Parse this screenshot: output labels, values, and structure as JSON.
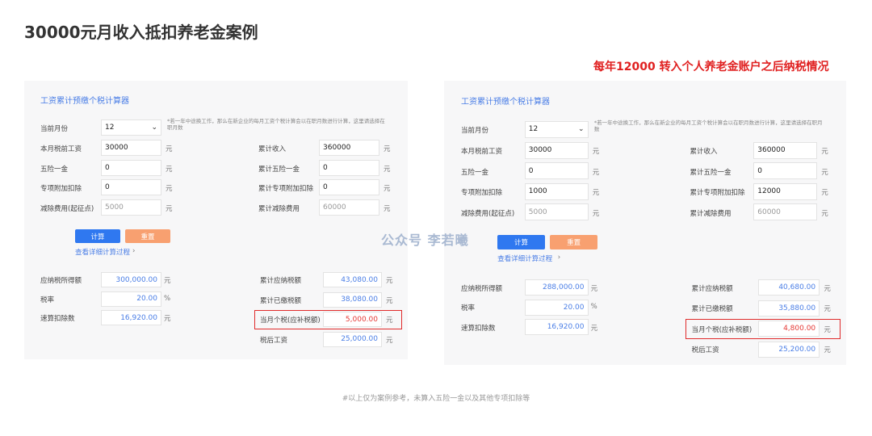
{
  "page": {
    "title": "30000元月收入抵扣养老金案例",
    "right_heading": "每年12000 转入个人养老金账户之后纳税情况",
    "watermark": "公众号 李若曦",
    "footnote": "#以上仅为案例参考，未算入五险一金以及其他专项扣除等"
  },
  "colors": {
    "accent": "#2f78f0",
    "reset": "#f8a070",
    "highlight": "#e02b2b"
  },
  "panels": [
    {
      "title": "工资累计预缴个税计算器",
      "month_label": "当前月份",
      "month_value": "12",
      "note": "*若一年中途换工作，那么在新企业的每月工资个税计算会以在职月数进行计算，这里请选择在职月数",
      "inputs": [
        {
          "label": "本月税前工资",
          "value": "30000",
          "unit": "元",
          "cum_label": "累计收入",
          "cum_value": "360000",
          "cum_unit": "元"
        },
        {
          "label": "五险一金",
          "value": "0",
          "unit": "元",
          "cum_label": "累计五险一金",
          "cum_value": "0",
          "cum_unit": "元"
        },
        {
          "label": "专项附加扣除",
          "value": "0",
          "unit": "元",
          "cum_label": "累计专项附加扣除",
          "cum_value": "0",
          "cum_unit": "元"
        },
        {
          "label": "减除费用(起征点)",
          "value": "5000",
          "unit": "元",
          "cum_label": "累计减除费用",
          "cum_value": "60000",
          "cum_unit": "元"
        }
      ],
      "calc_label": "计算",
      "reset_label": "重置",
      "detail_link": "查看详细计算过程",
      "results_left": [
        {
          "label": "应纳税所得额",
          "value": "300,000.00",
          "unit": "元"
        },
        {
          "label": "税率",
          "value": "20.00",
          "unit": "%"
        },
        {
          "label": "速算扣除数",
          "value": "16,920.00",
          "unit": "元"
        }
      ],
      "results_right": [
        {
          "label": "累计应纳税额",
          "value": "43,080.00",
          "unit": "元"
        },
        {
          "label": "累计已缴税额",
          "value": "38,080.00",
          "unit": "元"
        },
        {
          "label": "当月个税(应补税额)",
          "value": "5,000.00",
          "unit": "元"
        },
        {
          "label": "税后工资",
          "value": "25,000.00",
          "unit": "元"
        }
      ]
    },
    {
      "title": "工资累计预缴个税计算器",
      "month_label": "当前月份",
      "month_value": "12",
      "note": "*若一年中途换工作，那么在新企业的每月工资个税计算会以在职月数进行计算，这里请选择在职月数",
      "inputs": [
        {
          "label": "本月税前工资",
          "value": "30000",
          "unit": "元",
          "cum_label": "累计收入",
          "cum_value": "360000",
          "cum_unit": "元"
        },
        {
          "label": "五险一金",
          "value": "0",
          "unit": "元",
          "cum_label": "累计五险一金",
          "cum_value": "0",
          "cum_unit": "元"
        },
        {
          "label": "专项附加扣除",
          "value": "1000",
          "unit": "元",
          "cum_label": "累计专项附加扣除",
          "cum_value": "12000",
          "cum_unit": "元"
        },
        {
          "label": "减除费用(起征点)",
          "value": "5000",
          "unit": "元",
          "cum_label": "累计减除费用",
          "cum_value": "60000",
          "cum_unit": "元"
        }
      ],
      "calc_label": "计算",
      "reset_label": "重置",
      "detail_link": "查看详细计算过程",
      "results_left": [
        {
          "label": "应纳税所得额",
          "value": "288,000.00",
          "unit": "元"
        },
        {
          "label": "税率",
          "value": "20.00",
          "unit": "%"
        },
        {
          "label": "速算扣除数",
          "value": "16,920.00",
          "unit": "元"
        }
      ],
      "results_right": [
        {
          "label": "累计应纳税额",
          "value": "40,680.00",
          "unit": "元"
        },
        {
          "label": "累计已缴税额",
          "value": "35,880.00",
          "unit": "元"
        },
        {
          "label": "当月个税(应补税额)",
          "value": "4,800.00",
          "unit": "元"
        },
        {
          "label": "税后工资",
          "value": "25,200.00",
          "unit": "元"
        }
      ]
    }
  ]
}
